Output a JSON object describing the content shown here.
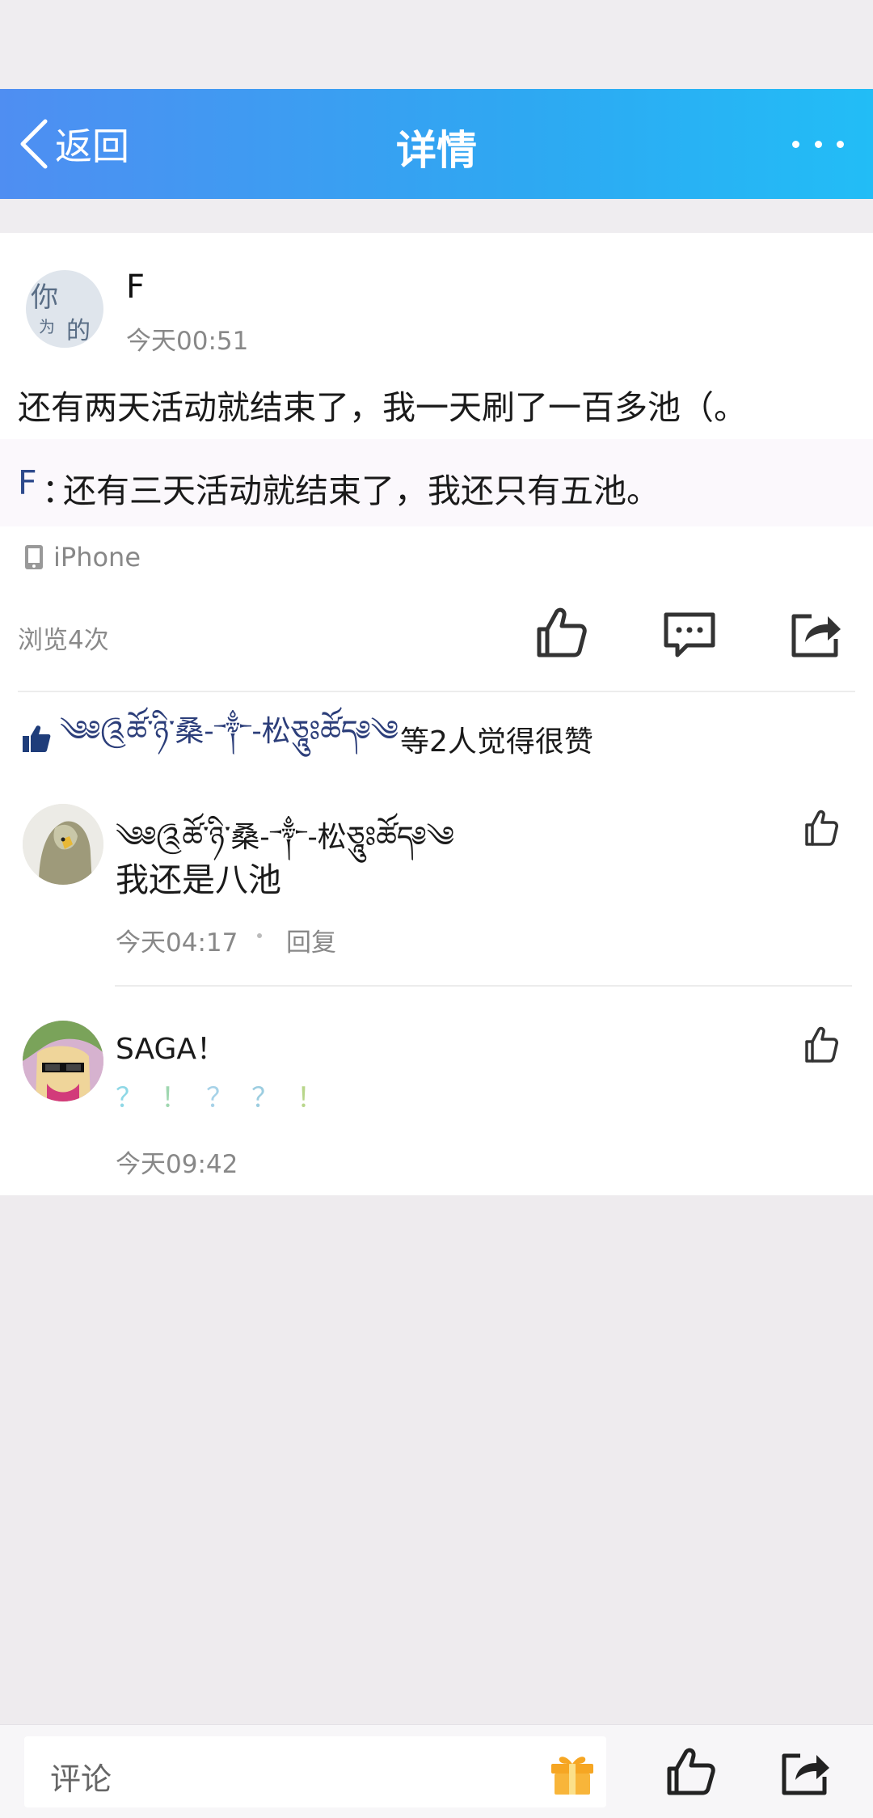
{
  "nav": {
    "back_label": "返回",
    "title": "详情"
  },
  "post": {
    "author": "F",
    "time": "今天00:51",
    "body": "还有两天活动就结束了，我一天刷了一百多池（。",
    "quote": {
      "author": "F",
      "colon": "：",
      "text": "还有三天活动就结束了，我还只有五池。"
    },
    "device": "iPhone",
    "views": "浏览4次"
  },
  "likes": {
    "likers": "༄༅༊ཚོ་ཉི་桑-༒-松ཅཱུཿཚོད༅༄",
    "suffix": "等2人觉得很赞"
  },
  "comments": [
    {
      "name": "༄༅༊ཚོ་ཉི་桑-༒-松ཅཱུཿཚོད༅༄",
      "text": "我还是八池",
      "time": "今天04:17",
      "reply_label": "回复"
    },
    {
      "name": "SAGA！",
      "text_chars": [
        "？",
        "！",
        "？",
        "？",
        "！"
      ],
      "time": "今天09:42"
    }
  ],
  "bottom": {
    "comment_label": "评论"
  },
  "colors": {
    "nav_start": "#4f8ef2",
    "nav_end": "#22bdf6",
    "quote_author": "#2d4a8c",
    "colorful": [
      "#8fd8e6",
      "#9fd7b0",
      "#a6d2e8",
      "#9ccde0",
      "#b8d68a"
    ]
  },
  "icons": [
    "back-chevron-icon",
    "more-icon",
    "phone-icon",
    "thumbs-up-icon",
    "comment-icon",
    "share-icon",
    "gift-icon"
  ]
}
